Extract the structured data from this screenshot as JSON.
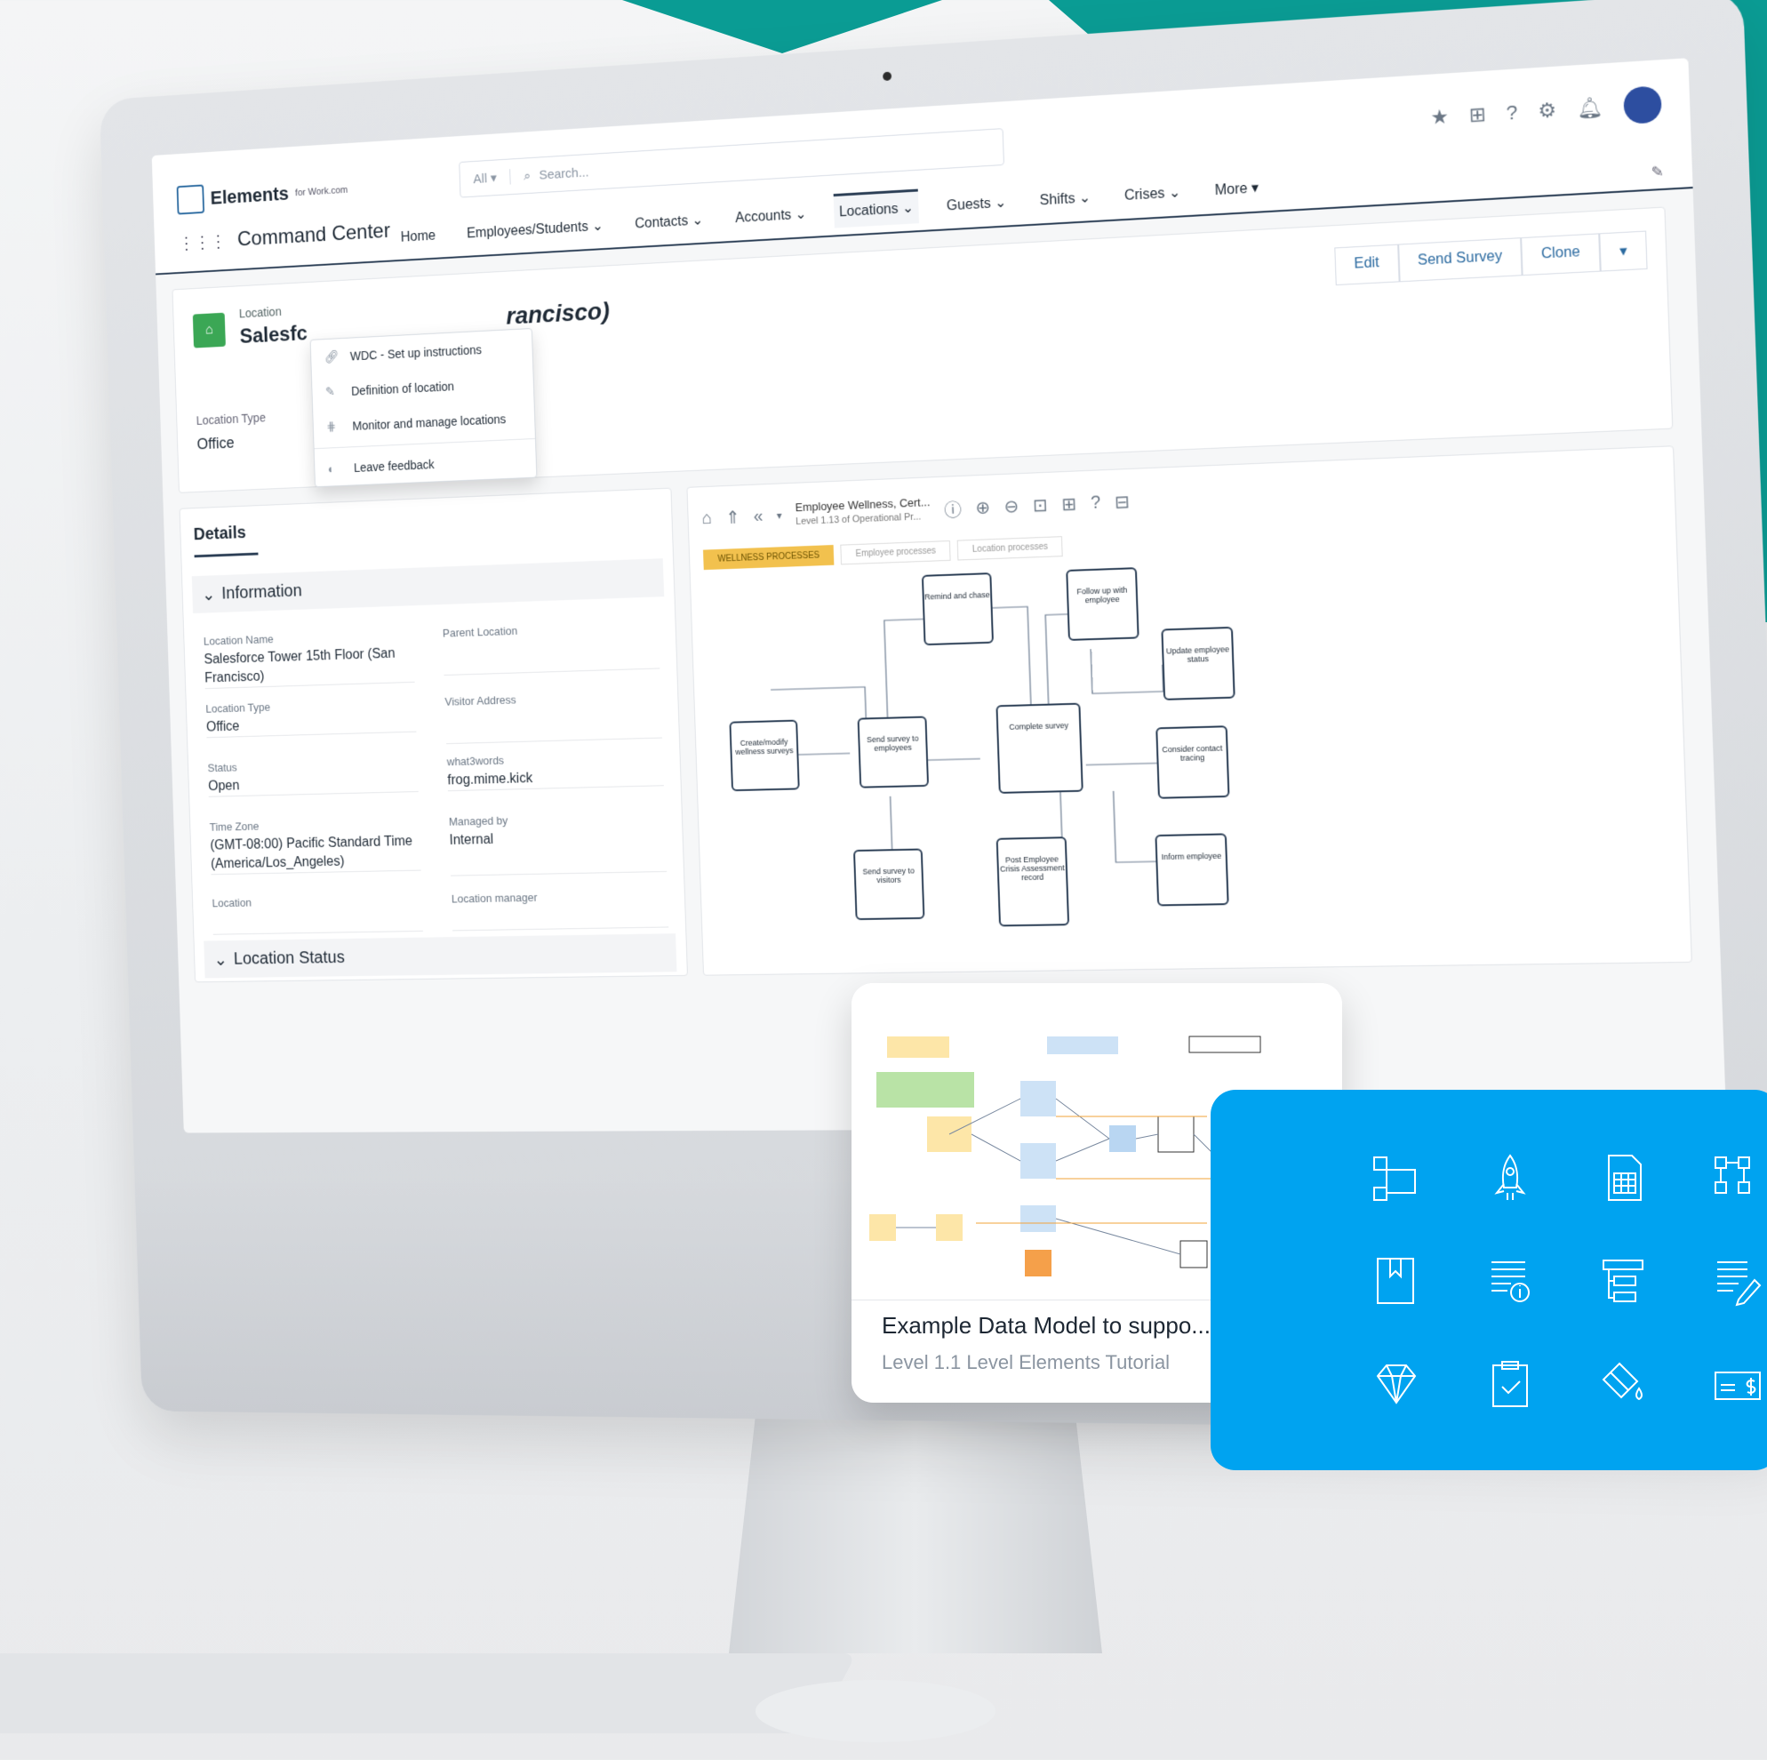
{
  "app": {
    "brand": "Elements",
    "brand_sub": "for Work.com",
    "name": "Command Center"
  },
  "search": {
    "scope": "All ▾",
    "placeholder": "Search..."
  },
  "nav": {
    "tabs": [
      {
        "label": "Home"
      },
      {
        "label": "Employees/Students ⌄"
      },
      {
        "label": "Contacts ⌄"
      },
      {
        "label": "Accounts ⌄"
      },
      {
        "label": "Locations ⌄"
      },
      {
        "label": "Guests ⌄"
      },
      {
        "label": "Shifts ⌄"
      },
      {
        "label": "Crises ⌄"
      },
      {
        "label": "More ▾"
      }
    ],
    "active_index": 4
  },
  "record": {
    "object_label": "Location",
    "title_left": "Salesfc",
    "title_right": "rancisco)",
    "buttons": [
      "Edit",
      "Send Survey",
      "Clone",
      "▾"
    ],
    "location_type_label": "Location Type",
    "location_type_value": "Office"
  },
  "dropdown": {
    "items": [
      "WDC - Set up instructions",
      "Definition of location",
      "Monitor and manage locations"
    ],
    "feedback": "Leave feedback"
  },
  "details": {
    "tab": "Details",
    "section_info": "Information",
    "section_status": "Location Status",
    "fields": {
      "location_name_label": "Location Name",
      "location_name_value": "Salesforce Tower 15th Floor (San Francisco)",
      "parent_location_label": "Parent Location",
      "location_type_label": "Location Type",
      "location_type_value": "Office",
      "visitor_address_label": "Visitor Address",
      "status_label": "Status",
      "status_value": "Open",
      "what3words_label": "what3words",
      "what3words_value": "frog.mime.kick",
      "timezone_label": "Time Zone",
      "timezone_value": "(GMT-08:00) Pacific Standard Time (America/Los_Angeles)",
      "managed_by_label": "Managed by",
      "managed_by_value": "Internal",
      "location_label": "Location",
      "location_manager_label": "Location manager"
    }
  },
  "diagram": {
    "title": "Employee Wellness, Cert...",
    "subtitle": "Level 1.13 of Operational Pr...",
    "tabs": [
      "WELLNESS PROCESSES",
      "Employee processes",
      "Location processes"
    ],
    "nodes": [
      {
        "label": "Remind and chase"
      },
      {
        "label": "Follow up with employee"
      },
      {
        "label": "Update employee status"
      },
      {
        "label": "Create/modify wellness surveys"
      },
      {
        "label": "Send survey to employees"
      },
      {
        "label": "Complete survey"
      },
      {
        "label": "Consider contact tracing"
      },
      {
        "label": "Send survey to visitors"
      },
      {
        "label": "Post Employee Crisis Assessment record"
      },
      {
        "label": "Inform employee"
      }
    ]
  },
  "card": {
    "title": "Example Data Model to suppo...",
    "subtitle": "Level 1.1 Level Elements Tutorial"
  },
  "colors": {
    "teal": "#0a9c94",
    "blue_panel": "#00a3f0",
    "nav_accent": "#2b3e55",
    "record_icon": "#3ba755"
  }
}
